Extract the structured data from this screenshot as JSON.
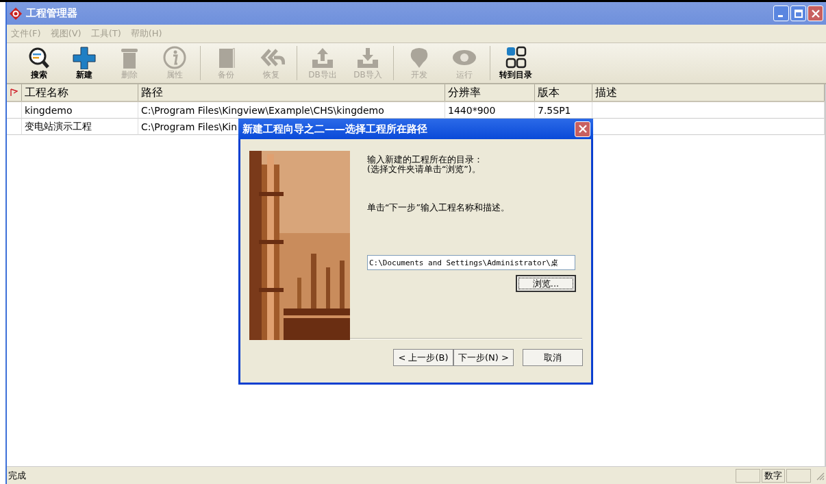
{
  "window": {
    "title": "工程管理器"
  },
  "menu": [
    {
      "label": "文件(F)",
      "disabled": true
    },
    {
      "label": "视图(V)",
      "disabled": true
    },
    {
      "label": "工具(T)",
      "disabled": true
    },
    {
      "label": "帮助(H)",
      "disabled": true
    }
  ],
  "toolbar": [
    {
      "label": "搜索",
      "disabled": false
    },
    {
      "label": "新建",
      "disabled": false
    },
    {
      "label": "删除",
      "disabled": true
    },
    {
      "label": "属性",
      "disabled": true
    },
    {
      "label": "备份",
      "disabled": true
    },
    {
      "label": "恢复",
      "disabled": true
    },
    {
      "label": "DB导出",
      "disabled": true
    },
    {
      "label": "DB导入",
      "disabled": true
    },
    {
      "label": "开发",
      "disabled": true
    },
    {
      "label": "运行",
      "disabled": true
    },
    {
      "label": "转到目录",
      "disabled": false
    }
  ],
  "table": {
    "columns": [
      "工程名称",
      "路径",
      "分辨率",
      "版本",
      "描述"
    ],
    "rows": [
      {
        "cells": [
          "kingdemo",
          "C:\\Program Files\\Kingview\\Example\\CHS\\kingdemo",
          "1440*900",
          "7.5SP1"
        ]
      },
      {
        "cells": [
          "变电站演示工程",
          "C:\\Program Files\\Kin"
        ]
      }
    ]
  },
  "dialog": {
    "title": "新建工程向导之二——选择工程所在路径",
    "instructions": [
      "输入新建的工程所在的目录：",
      "(选择文件夹请单击“浏览”)。"
    ],
    "hint": "单击“下一步”输入工程名称和描述。",
    "path_value": "C:\\Documents and Settings\\Administrator\\桌",
    "browse_button": "浏览...",
    "buttons": [
      "< 上一步(B)",
      "下一步(N) >",
      "取消"
    ]
  },
  "status_bar": {
    "message": "完成",
    "panels": [
      "数字"
    ]
  }
}
